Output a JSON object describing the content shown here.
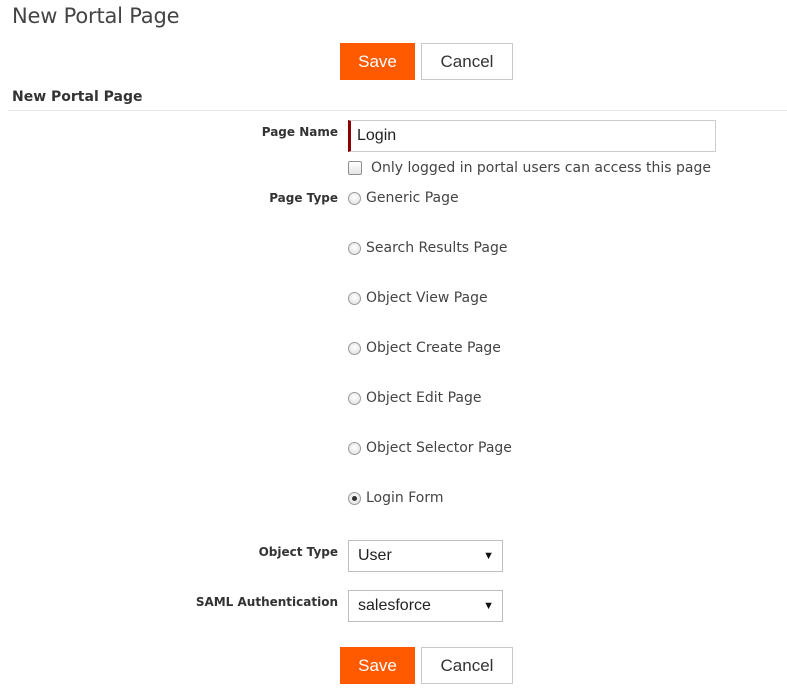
{
  "page": {
    "title": "New Portal Page",
    "section_header": "New Portal Page"
  },
  "buttons": {
    "save_label": "Save",
    "cancel_label": "Cancel",
    "save_color": "#ff5a00"
  },
  "form": {
    "page_name": {
      "label": "Page Name",
      "value": "Login"
    },
    "login_only": {
      "label": "Only logged in portal users can access this page",
      "checked": false
    },
    "page_type": {
      "label": "Page Type",
      "options": [
        {
          "label": "Generic Page",
          "selected": false
        },
        {
          "label": "Search Results Page",
          "selected": false
        },
        {
          "label": "Object View Page",
          "selected": false
        },
        {
          "label": "Object Create Page",
          "selected": false
        },
        {
          "label": "Object Edit Page",
          "selected": false
        },
        {
          "label": "Object Selector Page",
          "selected": false
        },
        {
          "label": "Login Form",
          "selected": true
        }
      ]
    },
    "object_type": {
      "label": "Object Type",
      "value": "User"
    },
    "saml_authentication": {
      "label": "SAML Authentication",
      "value": "salesforce"
    }
  },
  "icons": {
    "dropdown": "chevron-down-icon",
    "radio_selected": "radio-selected-icon"
  }
}
